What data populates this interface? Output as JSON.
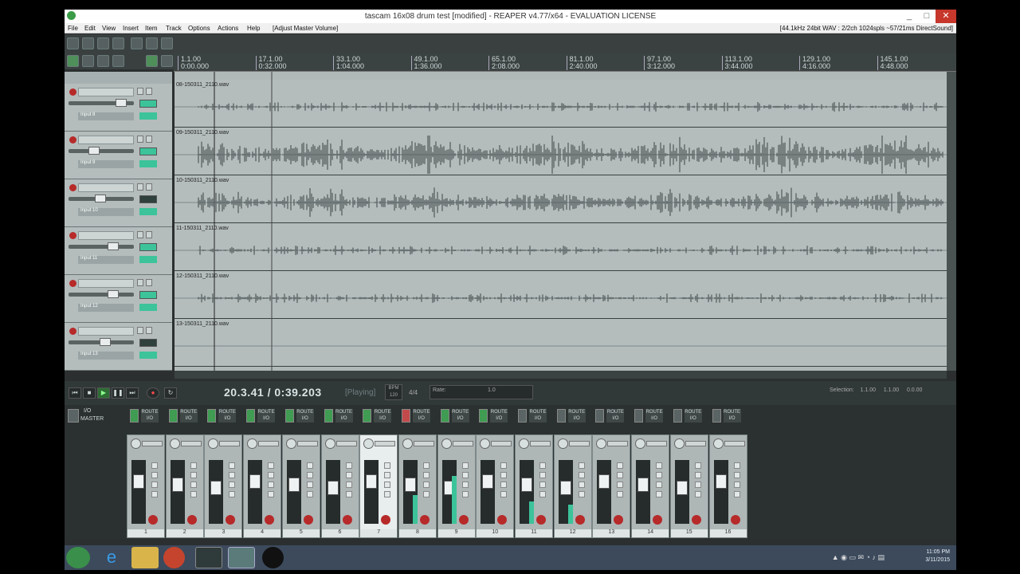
{
  "window": {
    "title": "tascam 16x08 drum test [modified] - REAPER v4.77/x64 - EVALUATION LICENSE",
    "minimize": "_",
    "maximize": "□",
    "close": "✕"
  },
  "menu": {
    "items": [
      "File",
      "Edit",
      "View",
      "Insert",
      "Item",
      "Track",
      "Options",
      "Actions",
      "Help"
    ],
    "extra": "[Adjust Master Volume]",
    "audio_status": "[44.1kHz 24bit WAV : 2/2ch 1024spls ~57/21ms DirectSound]"
  },
  "timeline": {
    "markers": [
      {
        "bar": "1.1.00",
        "time": "0:00.000"
      },
      {
        "bar": "17.1.00",
        "time": "0:32.000"
      },
      {
        "bar": "33.1.00",
        "time": "1:04.000"
      },
      {
        "bar": "49.1.00",
        "time": "1:36.000"
      },
      {
        "bar": "65.1.00",
        "time": "2:08.000"
      },
      {
        "bar": "81.1.00",
        "time": "2:40.000"
      },
      {
        "bar": "97.1.00",
        "time": "3:12.000"
      },
      {
        "bar": "113.1.00",
        "time": "3:44.000"
      },
      {
        "bar": "129.1.00",
        "time": "4:16.000"
      },
      {
        "bar": "145.1.00",
        "time": "4:48.000"
      }
    ]
  },
  "tracks": [
    {
      "item": "08-150311_2110.wav",
      "input": "Input 8",
      "density": 0.15
    },
    {
      "item": "09-150311_2110.wav",
      "input": "Input 9",
      "density": 0.9
    },
    {
      "item": "10-150311_2110.wav",
      "input": "Input 10",
      "density": 0.7
    },
    {
      "item": "11-150311_2110.wav",
      "input": "Input 11",
      "density": 0.25
    },
    {
      "item": "12-150311_2110.wav",
      "input": "Input 12",
      "density": 0.25
    },
    {
      "item": "13-150311_2110.wav",
      "input": "Input 13",
      "density": 0.0
    }
  ],
  "transport": {
    "time": "20.3.41 / 0:39.203",
    "status": "[Playing]",
    "bpm_label": "BPM",
    "bpm": "120",
    "timesig": "4/4",
    "rate_label": "Rate:",
    "rate_value": "1.0",
    "selection_label": "Selection:",
    "selection_start": "1.1.00",
    "selection_end": "1.1.00",
    "selection_len": "0.0.00"
  },
  "mixer": {
    "master_label": "MASTER",
    "io_label": "I/O",
    "route_label": "ROUTE",
    "channels": [
      {
        "num": "1",
        "level": 0.0,
        "arm": "green"
      },
      {
        "num": "2",
        "level": 0.0,
        "arm": "green"
      },
      {
        "num": "3",
        "level": 0.0,
        "arm": "green"
      },
      {
        "num": "4",
        "level": 0.0,
        "arm": "green"
      },
      {
        "num": "5",
        "level": 0.0,
        "arm": "green"
      },
      {
        "num": "6",
        "level": 0.0,
        "arm": "green"
      },
      {
        "num": "7",
        "level": 0.0,
        "arm": "green",
        "selected": true
      },
      {
        "num": "8",
        "level": 0.45,
        "arm": "red"
      },
      {
        "num": "9",
        "level": 0.75,
        "arm": "green"
      },
      {
        "num": "10",
        "level": 0.0,
        "arm": "green"
      },
      {
        "num": "11",
        "level": 0.35,
        "arm": "grey"
      },
      {
        "num": "12",
        "level": 0.3,
        "arm": "grey"
      },
      {
        "num": "13",
        "level": 0.0,
        "arm": "grey"
      },
      {
        "num": "14",
        "level": 0.0,
        "arm": "grey"
      },
      {
        "num": "15",
        "level": 0.0,
        "arm": "grey"
      },
      {
        "num": "16",
        "level": 0.0,
        "arm": "grey"
      }
    ]
  },
  "taskbar": {
    "time": "11:05 PM",
    "date": "3/11/2015"
  },
  "colors": {
    "accent_green": "#3cc39a",
    "record_red": "#b72a2a",
    "waveform": "#3b4545"
  }
}
